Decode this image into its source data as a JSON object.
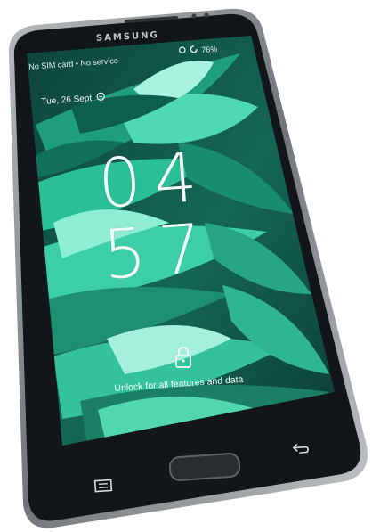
{
  "device": {
    "brand": "SAMSUNG"
  },
  "status_bar": {
    "carrier_text": "No SIM card • No service",
    "battery": "76%"
  },
  "lockscreen": {
    "date": "Tue, 26 Sept",
    "clock_hours": "04",
    "clock_minutes": "57",
    "unlock_hint": "Unlock for all features and data"
  },
  "icons": {
    "date_icon": "weather-icon",
    "lock_icon": "padlock-icon",
    "home_button": "home-button",
    "menu_key": "menu-icon",
    "back_key": "back-arrow-icon"
  },
  "colors": {
    "wallpaper_green": "#2fbf99",
    "wallpaper_dark": "#0b3a33",
    "bezel": "#111416",
    "frame": "#8d9497"
  }
}
